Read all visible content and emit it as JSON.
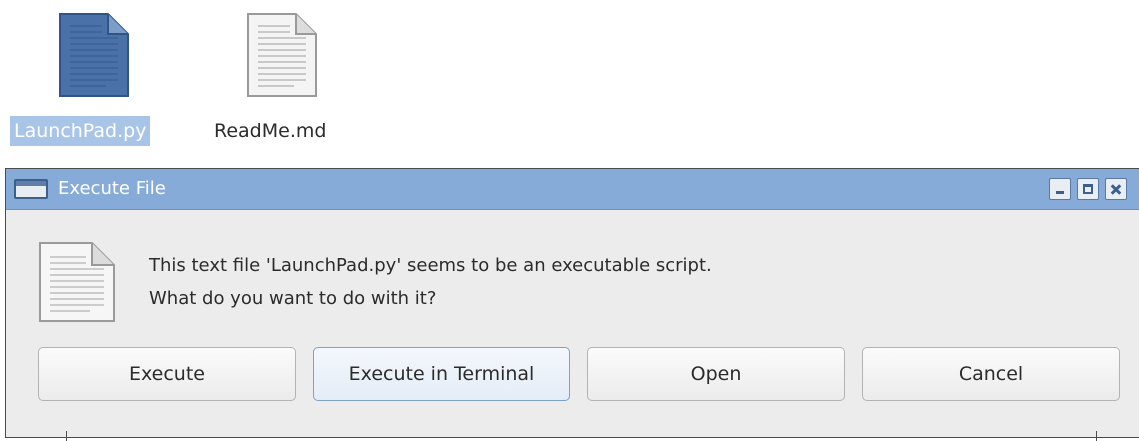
{
  "desktop": {
    "icons": [
      {
        "label": "LaunchPad.py",
        "selected": true
      },
      {
        "label": "ReadMe.md",
        "selected": false
      }
    ]
  },
  "dialog": {
    "title": "Execute File",
    "message_line1": "This text file 'LaunchPad.py' seems to be an executable script.",
    "message_line2": "What do you want to do with it?",
    "buttons": {
      "execute": "Execute",
      "execute_in_terminal": "Execute in Terminal",
      "open": "Open",
      "cancel": "Cancel"
    },
    "focused_button": "Execute in Terminal"
  },
  "colors": {
    "titlebar": "#87abd9",
    "selection": "#a8c4e6",
    "dialog_bg": "#ececec",
    "selected_file_icon": "#4a72a8"
  },
  "icons": {
    "selected_file": "python-file-icon",
    "readme_file": "text-file-icon",
    "dialog_message": "text-file-icon",
    "titlebar": "window-icon"
  }
}
